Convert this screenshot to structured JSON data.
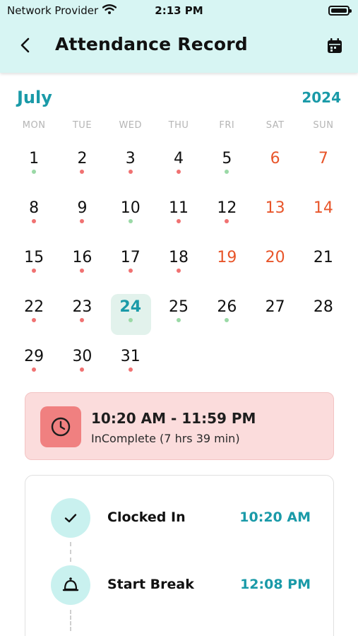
{
  "status_bar": {
    "carrier": "Network Provider",
    "time": "2:13 PM"
  },
  "header": {
    "title": "Attendance Record"
  },
  "calendar": {
    "month": "July",
    "year": "2024",
    "weekdays": [
      "MON",
      "TUE",
      "WED",
      "THU",
      "FRI",
      "SAT",
      "SUN"
    ],
    "days": [
      {
        "n": "1",
        "dot": "green"
      },
      {
        "n": "2",
        "dot": "red"
      },
      {
        "n": "3",
        "dot": "red"
      },
      {
        "n": "4",
        "dot": "red"
      },
      {
        "n": "5",
        "dot": "green"
      },
      {
        "n": "6",
        "weekend": true
      },
      {
        "n": "7",
        "weekend": true
      },
      {
        "n": "8",
        "dot": "red"
      },
      {
        "n": "9",
        "dot": "red"
      },
      {
        "n": "10",
        "dot": "green"
      },
      {
        "n": "11",
        "dot": "red"
      },
      {
        "n": "12",
        "dot": "red"
      },
      {
        "n": "13",
        "weekend": true
      },
      {
        "n": "14",
        "weekend": true
      },
      {
        "n": "15",
        "dot": "red"
      },
      {
        "n": "16",
        "dot": "red"
      },
      {
        "n": "17",
        "dot": "red"
      },
      {
        "n": "18",
        "dot": "red"
      },
      {
        "n": "19",
        "weekend": true
      },
      {
        "n": "20",
        "weekend": true
      },
      {
        "n": "21"
      },
      {
        "n": "22",
        "dot": "red"
      },
      {
        "n": "23",
        "dot": "red"
      },
      {
        "n": "24",
        "dot": "green",
        "selected": true
      },
      {
        "n": "25",
        "dot": "green"
      },
      {
        "n": "26",
        "dot": "green"
      },
      {
        "n": "27"
      },
      {
        "n": "28"
      },
      {
        "n": "29",
        "dot": "red"
      },
      {
        "n": "30",
        "dot": "red"
      },
      {
        "n": "31",
        "dot": "red"
      }
    ]
  },
  "summary": {
    "range": "10:20 AM - 11:59 PM",
    "status": "InComplete (7 hrs 39 min)"
  },
  "timeline": [
    {
      "label": "Clocked In",
      "time": "10:20 AM",
      "icon": "check-icon"
    },
    {
      "label": "Start Break",
      "time": "12:08 PM",
      "icon": "bell-icon"
    }
  ],
  "colors": {
    "accent": "#1a9aa8",
    "weekend": "#e8552a",
    "dot_red": "#f07272",
    "dot_green": "#9ad9a6",
    "header_bg": "#d7f5f3",
    "summary_bg": "#fbdcdc"
  }
}
